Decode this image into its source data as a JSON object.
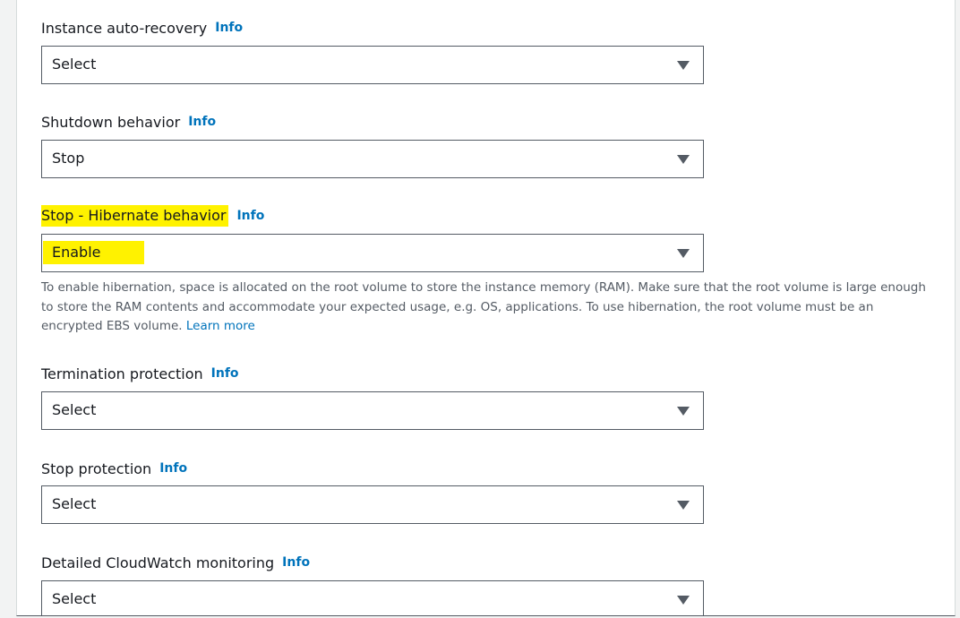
{
  "fields": [
    {
      "label": "Instance auto-recovery",
      "info": "Info",
      "value": "Select"
    },
    {
      "label": "Shutdown behavior",
      "info": "Info",
      "value": "Stop"
    },
    {
      "label": "Stop - Hibernate behavior",
      "info": "Info",
      "value": "Enable",
      "hint": "To enable hibernation, space is allocated on the root volume to store the instance memory (RAM). Make sure that the root volume is large enough to store the RAM contents and accommodate your expected usage, e.g. OS, applications. To use hibernation, the root volume must be an encrypted EBS volume.",
      "hint_link": "Learn more"
    },
    {
      "label": "Termination protection",
      "info": "Info",
      "value": "Select"
    },
    {
      "label": "Stop protection",
      "info": "Info",
      "value": "Select"
    },
    {
      "label": "Detailed CloudWatch monitoring",
      "info": "Info",
      "value": "Select"
    }
  ],
  "colors": {
    "info_link": "#0073bb",
    "highlight": "#fff200",
    "border": "#545b64"
  }
}
